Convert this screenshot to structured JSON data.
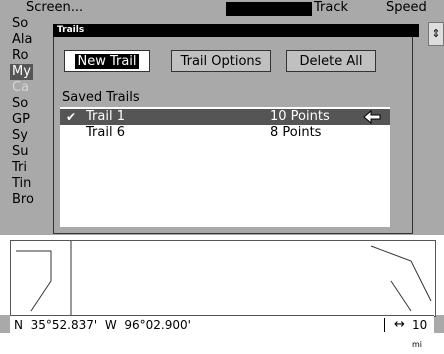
{
  "topbar": {
    "title": "Screen...",
    "track_label": "Track",
    "speed_label": "Speed"
  },
  "background_menu": {
    "items": [
      "So",
      "Ala",
      "Ro",
      "My",
      "Ca",
      "So",
      "GP",
      "Sy",
      "Su",
      "Tri",
      "Tin",
      "Bro"
    ]
  },
  "dialog": {
    "title": "Trails",
    "buttons": {
      "new_trail": "New Trail",
      "trail_options": "Trail Options",
      "delete_all": "Delete All"
    },
    "saved_trails_label": "Saved Trails",
    "trails": [
      {
        "name": "Trail 1",
        "points": "10 Points",
        "checked": true,
        "selected": true
      },
      {
        "name": "Trail 6",
        "points": "8 Points",
        "checked": false,
        "selected": false
      }
    ]
  },
  "status": {
    "lat_prefix": "N",
    "lat": "35°52.837'",
    "lon_prefix": "W",
    "lon": "96°02.900'",
    "scale_value": "10",
    "scale_unit": "mi"
  },
  "colors": {
    "background": "#a9a9a9",
    "selected_row": "#555555",
    "title_bar": "#000000"
  }
}
